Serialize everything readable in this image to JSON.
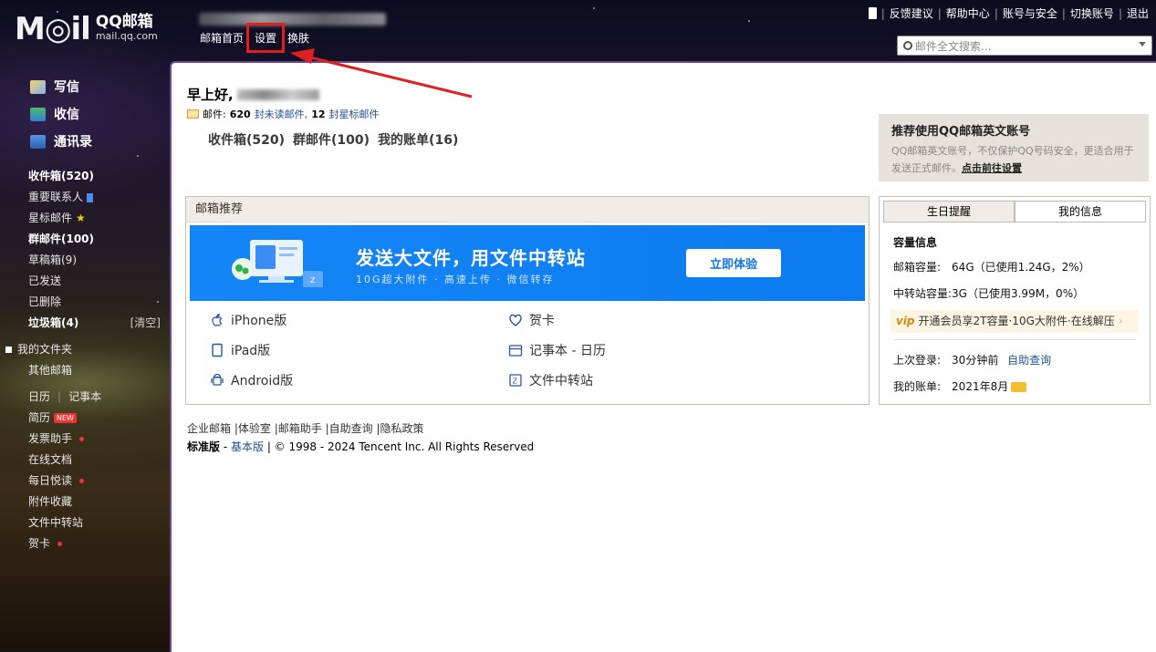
{
  "header": {
    "logo_mark": "M◎il",
    "logo_cn": "QQ邮箱",
    "logo_en": "mail.qq.com",
    "nav": [
      "邮箱首页",
      "设置",
      "换肤"
    ],
    "links": [
      "反馈建议",
      "帮助中心",
      "账号与安全",
      "切换账号",
      "退出"
    ],
    "search_placeholder": "邮件全文搜索..."
  },
  "sidebar": {
    "main_actions": [
      {
        "label": "写信",
        "icon": "write-icon"
      },
      {
        "label": "收信",
        "icon": "inbox-download-icon"
      },
      {
        "label": "通讯录",
        "icon": "contacts-icon"
      }
    ],
    "folders": [
      {
        "label": "收件箱(520)",
        "bold": true
      },
      {
        "label": "重要联系人",
        "bold": false
      },
      {
        "label": "星标邮件",
        "bold": false
      },
      {
        "label": "群邮件(100)",
        "bold": true
      },
      {
        "label": "草稿箱(9)",
        "bold": false
      },
      {
        "label": "已发送",
        "bold": false
      },
      {
        "label": "已删除",
        "bold": false
      },
      {
        "label": "垃圾箱(4)",
        "bold": true
      }
    ],
    "clear_label": "[清空]",
    "my_folders": "我的文件夹",
    "other_mail": "其他邮箱",
    "calendar": "日历",
    "notebook": "记事本",
    "tools": [
      {
        "label": "简历",
        "badge": "NEW"
      },
      {
        "label": "发票助手",
        "dot": true
      },
      {
        "label": "在线文档"
      },
      {
        "label": "每日悦读",
        "dot": true
      },
      {
        "label": "附件收藏"
      },
      {
        "label": "文件中转站"
      },
      {
        "label": "贺卡",
        "dot": true
      }
    ]
  },
  "main": {
    "greeting": "早上好,",
    "mail_label": "邮件:",
    "unread_count": "620",
    "unread_text": "封未读邮件,",
    "star_count": "12",
    "star_text": "封星标邮件",
    "quicklinks": [
      "收件箱(520)",
      "群邮件(100)",
      "我的账单(16)"
    ]
  },
  "promo": {
    "title": "推荐使用QQ邮箱英文账号",
    "desc": "QQ邮箱英文账号，不仅保护QQ号码安全，更适合用于发送正式邮件。",
    "link": "点击前往设置"
  },
  "recommend": {
    "header": "邮箱推荐",
    "banner_title": "发送大文件，用文件中转站",
    "banner_sub": "10G超大附件 · 高速上传 · 微信转存",
    "banner_button": "立即体验",
    "apps_left": [
      {
        "label": "iPhone版",
        "icon": "apple-icon"
      },
      {
        "label": "iPad版",
        "icon": "tablet-icon"
      },
      {
        "label": "Android版",
        "icon": "android-icon"
      }
    ],
    "apps_right": [
      {
        "label": "贺卡",
        "icon": "heart-icon"
      },
      {
        "label": "记事本 - 日历",
        "icon": "calendar-icon"
      },
      {
        "label": "文件中转站",
        "icon": "file-transfer-icon"
      }
    ]
  },
  "info_panel": {
    "tabs": [
      "生日提醒",
      "我的信息"
    ],
    "active_tab": 1,
    "capacity_title": "容量信息",
    "mail_capacity_label": "邮箱容量:",
    "mail_capacity_value": "64G（已使用1.24G，2%）",
    "transfer_capacity_label": "中转站容量:",
    "transfer_capacity_value": "3G（已使用3.99M，0%）",
    "vip_promo": "开通会员享2T容量·10G大附件·在线解压",
    "last_login_label": "上次登录:",
    "last_login_value": "30分钟前",
    "self_query": "自助查询",
    "bill_label": "我的账单:",
    "bill_value": "2021年8月"
  },
  "footer": {
    "links": [
      "企业邮箱",
      "体验室",
      "邮箱助手",
      "自助查询",
      "隐私政策"
    ],
    "version_current": "标准版",
    "version_basic": "基本版",
    "copyright": "© 1998 - 2024 Tencent Inc. All Rights Reserved"
  },
  "colors": {
    "accent_purple": "#6e4a8a",
    "banner_blue": "#1586f6",
    "annotation_red": "#e02020"
  }
}
